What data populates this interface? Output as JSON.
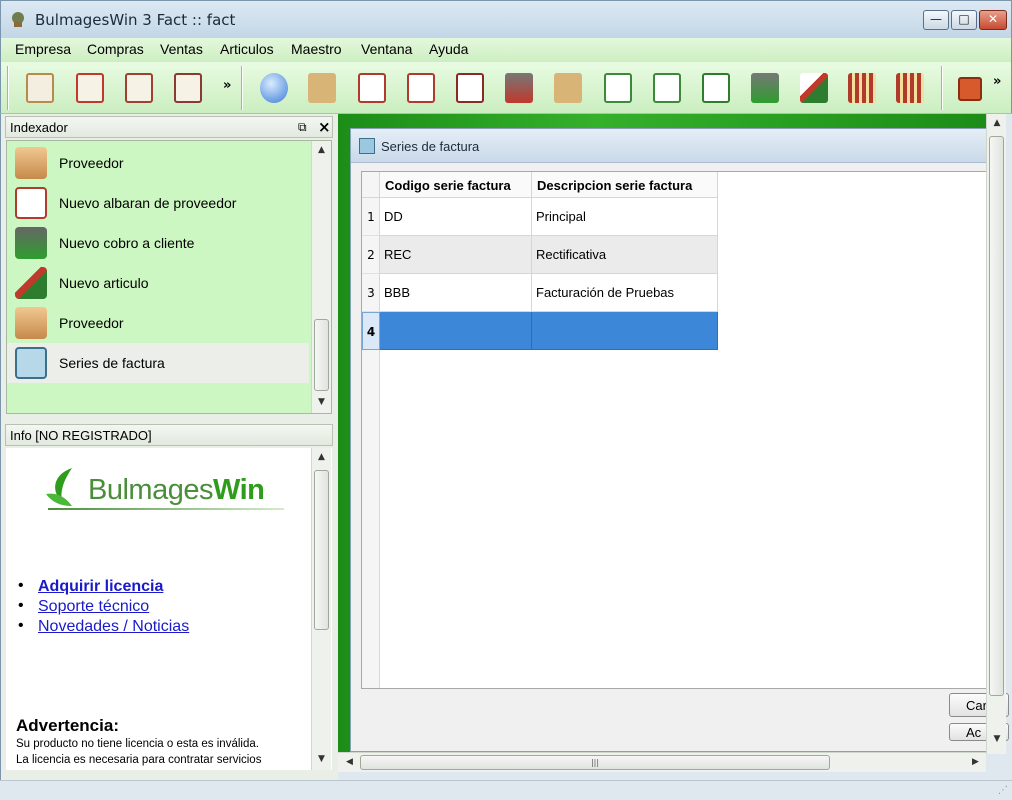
{
  "window": {
    "title": "BulmagesWin 3 Fact :: fact",
    "min_label": "—",
    "max_label": "□",
    "close_label": "✕"
  },
  "menu": [
    "Empresa",
    "Compras",
    "Ventas",
    "Articulos",
    "Maestro",
    "Ventana",
    "Ayuda"
  ],
  "toolbar": {
    "overflow_left": "»",
    "overflow_right": "»"
  },
  "indexador": {
    "title": "Indexador",
    "items": [
      {
        "label": "Proveedor",
        "icon": "supplier-icon"
      },
      {
        "label": "Nuevo albaran de proveedor",
        "icon": "delivery-note-icon"
      },
      {
        "label": "Nuevo cobro a cliente",
        "icon": "payment-icon"
      },
      {
        "label": "Nuevo articulo",
        "icon": "article-tools-icon"
      },
      {
        "label": "Proveedor",
        "icon": "supplier-icon"
      },
      {
        "label": "Series de factura",
        "icon": "invoice-series-icon"
      }
    ]
  },
  "info": {
    "title": "Info [NO REGISTRADO]",
    "logo_prefix": "Bulmages",
    "logo_bold": "Win",
    "links": [
      "Adquirir licencia",
      "Soporte técnico",
      "Novedades / Noticias"
    ],
    "warning_title": "Advertencia:",
    "warning_lines": [
      "Su producto no tiene licencia o esta es inválida.",
      "La licencia es necesaria para contratar servicios"
    ]
  },
  "child": {
    "title": "Series de factura",
    "columns": [
      "Codigo serie factura",
      "Descripcion serie factura"
    ],
    "rows": [
      {
        "num": "1",
        "code": "DD",
        "desc": "Principal"
      },
      {
        "num": "2",
        "code": "REC",
        "desc": "Rectificativa"
      },
      {
        "num": "3",
        "code": "BBB",
        "desc": "Facturación de Pruebas"
      },
      {
        "num": "4",
        "code": "",
        "desc": ""
      }
    ],
    "buttons": [
      "Car",
      "Ac"
    ]
  },
  "colors": {
    "accent_green": "#2f9d1c",
    "selection_blue": "#3d87d8",
    "index_bg": "#cdf7c2"
  }
}
